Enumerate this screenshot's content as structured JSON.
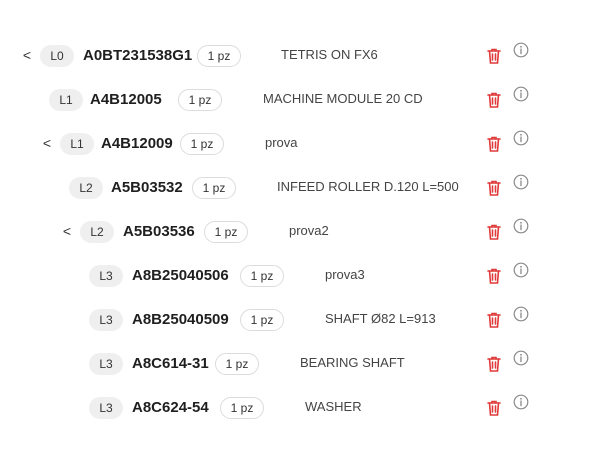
{
  "colors": {
    "delete": "#e03a3a",
    "info": "#8a8a8a",
    "chip": "#efefef"
  },
  "icons": {
    "expand": "chevron-left",
    "delete": "trash-icon",
    "info": "info-circle-icon"
  },
  "rows": [
    {
      "toggle": "<",
      "level": "L0",
      "code": "A0BT231538G1",
      "qty": "1 pz",
      "desc": "TETRIS ON FX6"
    },
    {
      "toggle": "",
      "level": "L1",
      "code": "A4B12005",
      "qty": "1 pz",
      "desc": "MACHINE MODULE 20 CD"
    },
    {
      "toggle": "<",
      "level": "L1",
      "code": "A4B12009",
      "qty": "1 pz",
      "desc": "prova"
    },
    {
      "toggle": "",
      "level": "L2",
      "code": "A5B03532",
      "qty": "1 pz",
      "desc": "INFEED ROLLER D.120 L=500"
    },
    {
      "toggle": "<",
      "level": "L2",
      "code": "A5B03536",
      "qty": "1 pz",
      "desc": "prova2"
    },
    {
      "toggle": "",
      "level": "L3",
      "code": "A8B25040506",
      "qty": "1 pz",
      "desc": "prova3"
    },
    {
      "toggle": "",
      "level": "L3",
      "code": "A8B25040509",
      "qty": "1 pz",
      "desc": "SHAFT Ø82 L=913"
    },
    {
      "toggle": "",
      "level": "L3",
      "code": "A8C614-31",
      "qty": "1 pz",
      "desc": "BEARING SHAFT"
    },
    {
      "toggle": "",
      "level": "L3",
      "code": "A8C624-54",
      "qty": "1 pz",
      "desc": "WASHER"
    }
  ]
}
